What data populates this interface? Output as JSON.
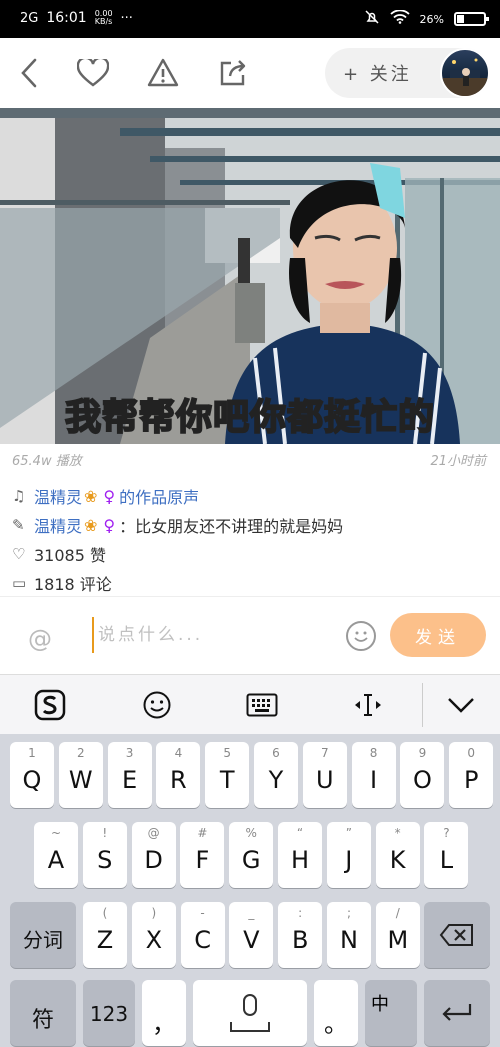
{
  "status": {
    "signal": "2G",
    "time": "16:01",
    "speed_top": "0.00",
    "speed_unit": "KB/s",
    "more": "···",
    "battery_pct": "26%",
    "battery_fill": 0.26
  },
  "header": {
    "follow_label": "+ 关注"
  },
  "video": {
    "subtitle": "我帮帮你吧你都挺忙的"
  },
  "stats": {
    "plays": "65.4w 播放",
    "posted": "21小时前"
  },
  "info": {
    "music_author": "温精灵",
    "music_suffix": "的作品原声",
    "caption_author": "温精灵",
    "caption_text": "：比女朋友还不讲理的就是妈妈",
    "likes": "31085 赞",
    "comments": "1818 评论"
  },
  "comment": {
    "placeholder": "说点什么...",
    "send_label": "发送"
  },
  "keyboard": {
    "row1": [
      {
        "hint": "1",
        "key": "Q"
      },
      {
        "hint": "2",
        "key": "W"
      },
      {
        "hint": "3",
        "key": "E"
      },
      {
        "hint": "4",
        "key": "R"
      },
      {
        "hint": "5",
        "key": "T"
      },
      {
        "hint": "6",
        "key": "Y"
      },
      {
        "hint": "7",
        "key": "U"
      },
      {
        "hint": "8",
        "key": "I"
      },
      {
        "hint": "9",
        "key": "O"
      },
      {
        "hint": "0",
        "key": "P"
      }
    ],
    "row2": [
      {
        "hint": "~",
        "key": "A"
      },
      {
        "hint": "!",
        "key": "S"
      },
      {
        "hint": "@",
        "key": "D"
      },
      {
        "hint": "#",
        "key": "F"
      },
      {
        "hint": "%",
        "key": "G"
      },
      {
        "hint": "“",
        "key": "H"
      },
      {
        "hint": "”",
        "key": "J"
      },
      {
        "hint": "*",
        "key": "K"
      },
      {
        "hint": "?",
        "key": "L"
      }
    ],
    "row3": [
      {
        "hint": "(",
        "key": "Z"
      },
      {
        "hint": ")",
        "key": "X"
      },
      {
        "hint": "-",
        "key": "C"
      },
      {
        "hint": "_",
        "key": "V"
      },
      {
        "hint": ":",
        "key": "B"
      },
      {
        "hint": ";",
        "key": "N"
      },
      {
        "hint": "/",
        "key": "M"
      }
    ],
    "fenci": "分词",
    "fu": "符",
    "num": "123",
    "comma": "，",
    "period": "。",
    "zhong": "中"
  }
}
